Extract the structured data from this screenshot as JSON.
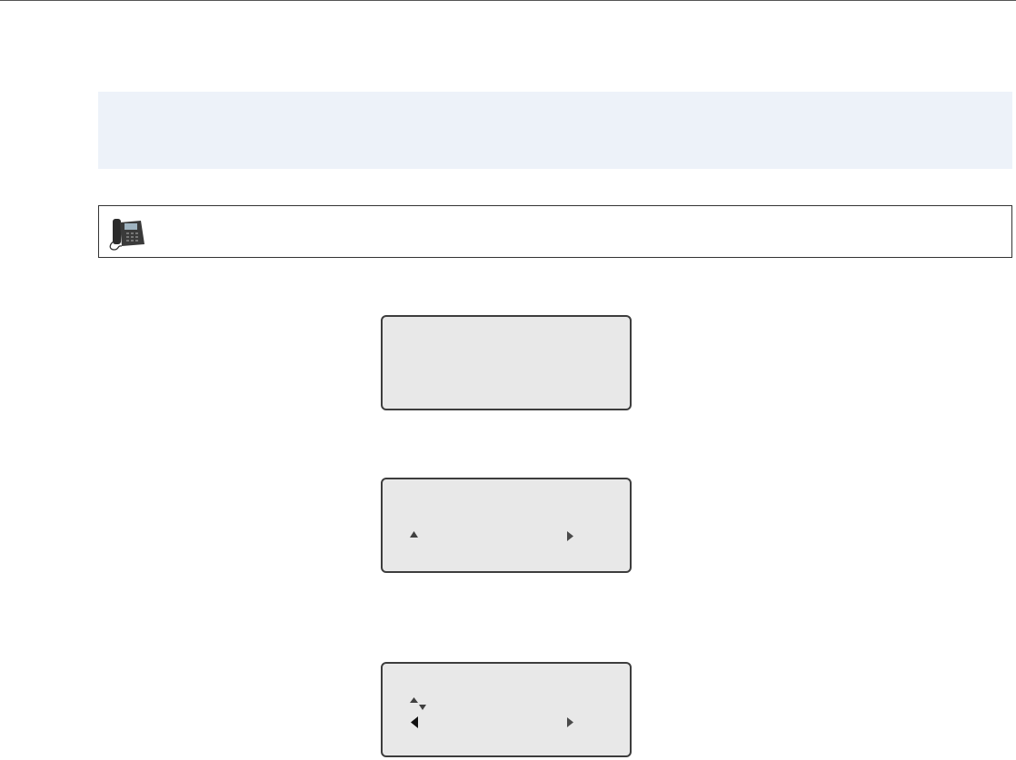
{
  "page": {
    "note": "",
    "phone_note": ""
  },
  "screens": [
    {
      "name": "lcd-screen-1",
      "lines": []
    },
    {
      "name": "lcd-screen-2",
      "indicators": [
        "up-arrow-icon",
        "right-arrow-icon"
      ]
    },
    {
      "name": "lcd-screen-3",
      "indicators": [
        "up-down-arrow-icon",
        "left-arrow-icon",
        "right-arrow-icon"
      ]
    }
  ],
  "colors": {
    "note_bg": "#edf2f9",
    "lcd_bg": "#e8e8e8",
    "lcd_border": "#3d3d3d"
  }
}
